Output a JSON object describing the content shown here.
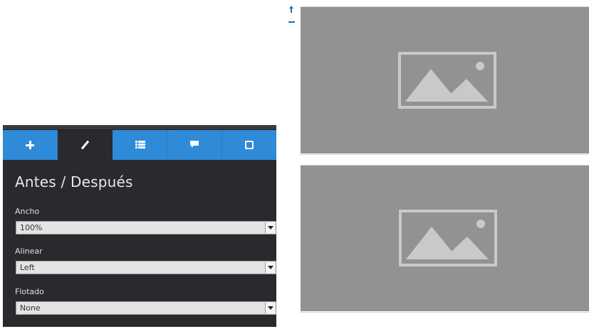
{
  "panel": {
    "tabs": [
      {
        "name": "add",
        "icon": "plus-icon",
        "active": false
      },
      {
        "name": "edit",
        "icon": "pencil-icon",
        "active": true
      },
      {
        "name": "layers",
        "icon": "list-icon",
        "active": false
      },
      {
        "name": "comments",
        "icon": "comment-icon",
        "active": false
      },
      {
        "name": "mobile",
        "icon": "mobile-icon",
        "active": false
      }
    ],
    "title": "Antes / Después",
    "fields": {
      "width": {
        "label": "Ancho",
        "value": "100%"
      },
      "align": {
        "label": "Alinear",
        "value": "Left"
      },
      "float": {
        "label": "Flotado",
        "value": "None"
      }
    }
  },
  "canvas": {
    "images": [
      {
        "icon": "image-placeholder-icon"
      },
      {
        "icon": "image-placeholder-icon"
      }
    ],
    "controls": {
      "move_up": "arrow-up-icon",
      "remove": "minus-icon"
    }
  },
  "colors": {
    "panel_bg": "#2a2a2e",
    "tab_blue": "#2f8ad8",
    "placeholder_gray": "#929292",
    "control_blue": "#1f6fb5"
  }
}
